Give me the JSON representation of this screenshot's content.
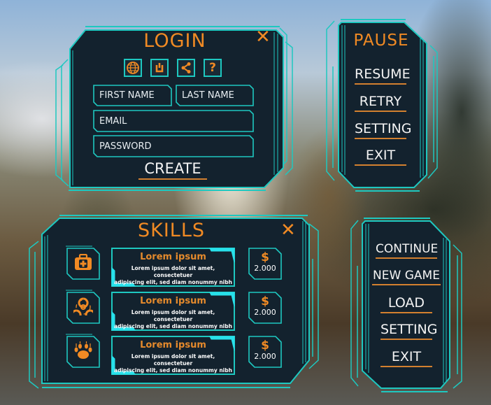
{
  "login": {
    "title": "LOGIN",
    "close_icon": "close-icon",
    "icon_buttons": [
      {
        "icon": "globe-icon"
      },
      {
        "icon": "power-icon"
      },
      {
        "icon": "share-icon"
      },
      {
        "icon": "help-icon"
      }
    ],
    "fields": {
      "first_name": "FIRST NAME",
      "last_name": "LAST NAME",
      "email": "EMAIL",
      "password": "PASSWORD"
    },
    "create_label": "CREATE"
  },
  "pause": {
    "title": "PAUSE",
    "items": [
      "RESUME",
      "RETRY",
      "SETTING",
      "EXIT"
    ]
  },
  "skills": {
    "title": "SKILLS",
    "close_icon": "close-icon",
    "rows": [
      {
        "icon": "medkit-icon",
        "name": "Lorem ipsum",
        "desc_line1": "Lorem ipsum dolor sit amet, consectetuer",
        "desc_line2": "adipiscing elit, sed diam nonummy nibh",
        "currency": "$",
        "price": "2.000"
      },
      {
        "icon": "biohazard-icon",
        "name": "Lorem ipsum",
        "desc_line1": "Lorem ipsum dolor sit amet, consectetuer",
        "desc_line2": "adipiscing elit, sed diam nonummy nibh",
        "currency": "$",
        "price": "2.000"
      },
      {
        "icon": "paw-icon",
        "name": "Lorem ipsum",
        "desc_line1": "Lorem ipsum dolor sit amet, consectetuer",
        "desc_line2": "adipiscing elit, sed diam nonummy nibh",
        "currency": "$",
        "price": "2.000"
      }
    ]
  },
  "main_menu": {
    "items": [
      "CONTINUE",
      "NEW GAME",
      "LOAD",
      "SETTING",
      "EXIT"
    ]
  },
  "colors": {
    "accent_orange": "#f08a24",
    "frame_cyan": "#1ec8c0",
    "panel_bg": "#13222e"
  }
}
